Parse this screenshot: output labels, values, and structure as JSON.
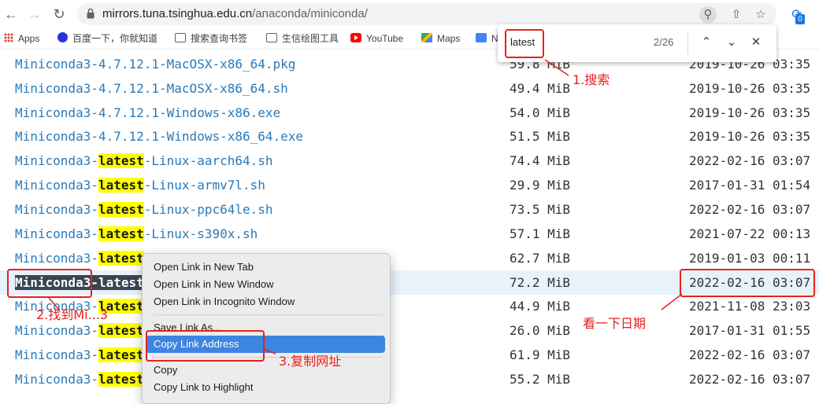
{
  "browser": {
    "url_host": "mirrors.tuna.tsinghua.edu.cn",
    "url_path": "/anaconda/miniconda/",
    "bookmarks": [
      "Apps",
      "百度一下，你就知道",
      "搜索查询书签",
      "生信绘图工具",
      "YouTube",
      "Maps",
      "N"
    ],
    "extension_badge": "0"
  },
  "find_bar": {
    "query": "latest",
    "count": "2/26"
  },
  "files": [
    {
      "prefix": "Miniconda3-4.7.12.1-MacOSX-x86_64.pkg",
      "hl": "",
      "suffix": "",
      "size": "59.8 MiB",
      "date": "2019-10-26 03:35"
    },
    {
      "prefix": "Miniconda3-4.7.12.1-MacOSX-x86_64.sh",
      "hl": "",
      "suffix": "",
      "size": "49.4 MiB",
      "date": "2019-10-26 03:35"
    },
    {
      "prefix": "Miniconda3-4.7.12.1-Windows-x86.exe",
      "hl": "",
      "suffix": "",
      "size": "54.0 MiB",
      "date": "2019-10-26 03:35"
    },
    {
      "prefix": "Miniconda3-4.7.12.1-Windows-x86_64.exe",
      "hl": "",
      "suffix": "",
      "size": "51.5 MiB",
      "date": "2019-10-26 03:35"
    },
    {
      "prefix": "Miniconda3-",
      "hl": "latest",
      "suffix": "-Linux-aarch64.sh",
      "size": "74.4 MiB",
      "date": "2022-02-16 03:07"
    },
    {
      "prefix": "Miniconda3-",
      "hl": "latest",
      "suffix": "-Linux-armv7l.sh",
      "size": "29.9 MiB",
      "date": "2017-01-31 01:54"
    },
    {
      "prefix": "Miniconda3-",
      "hl": "latest",
      "suffix": "-Linux-ppc64le.sh",
      "size": "73.5 MiB",
      "date": "2022-02-16 03:07"
    },
    {
      "prefix": "Miniconda3-",
      "hl": "latest",
      "suffix": "-Linux-s390x.sh",
      "size": "57.1 MiB",
      "date": "2021-07-22 00:13"
    },
    {
      "prefix": "Miniconda3-",
      "hl": "latest",
      "suffix": "",
      "size": "62.7 MiB",
      "date": "2019-01-03 00:11"
    },
    {
      "prefix": "Miniconda3-latest",
      "hl": "",
      "suffix": "",
      "size": "72.2 MiB",
      "date": "2022-02-16 03:07",
      "selected": true
    },
    {
      "prefix": "Miniconda3-",
      "hl": "latest",
      "suffix": "",
      "size": "44.9 MiB",
      "date": "2021-11-08 23:03"
    },
    {
      "prefix": "Miniconda3-",
      "hl": "latest",
      "suffix": "",
      "size": "26.0 MiB",
      "date": "2017-01-31 01:55"
    },
    {
      "prefix": "Miniconda3-",
      "hl": "latest",
      "suffix": "",
      "size": "61.9 MiB",
      "date": "2022-02-16 03:07"
    },
    {
      "prefix": "Miniconda3-",
      "hl": "latest",
      "suffix": "",
      "size": "55.2 MiB",
      "date": "2022-02-16 03:07"
    }
  ],
  "context_menu": {
    "open_new_tab": "Open Link in New Tab",
    "open_new_window": "Open Link in New Window",
    "open_incognito": "Open Link in Incognito Window",
    "save_link_as": "Save Link As...",
    "copy_link_address": "Copy Link Address",
    "copy": "Copy",
    "copy_link_highlight": "Copy Link to Highlight"
  },
  "annotations": {
    "step1": "1.搜索",
    "step2": "2.找到Mi...3",
    "step3": "3.复制网址",
    "date_note": "看一下日期",
    "color": "#e8201a"
  }
}
